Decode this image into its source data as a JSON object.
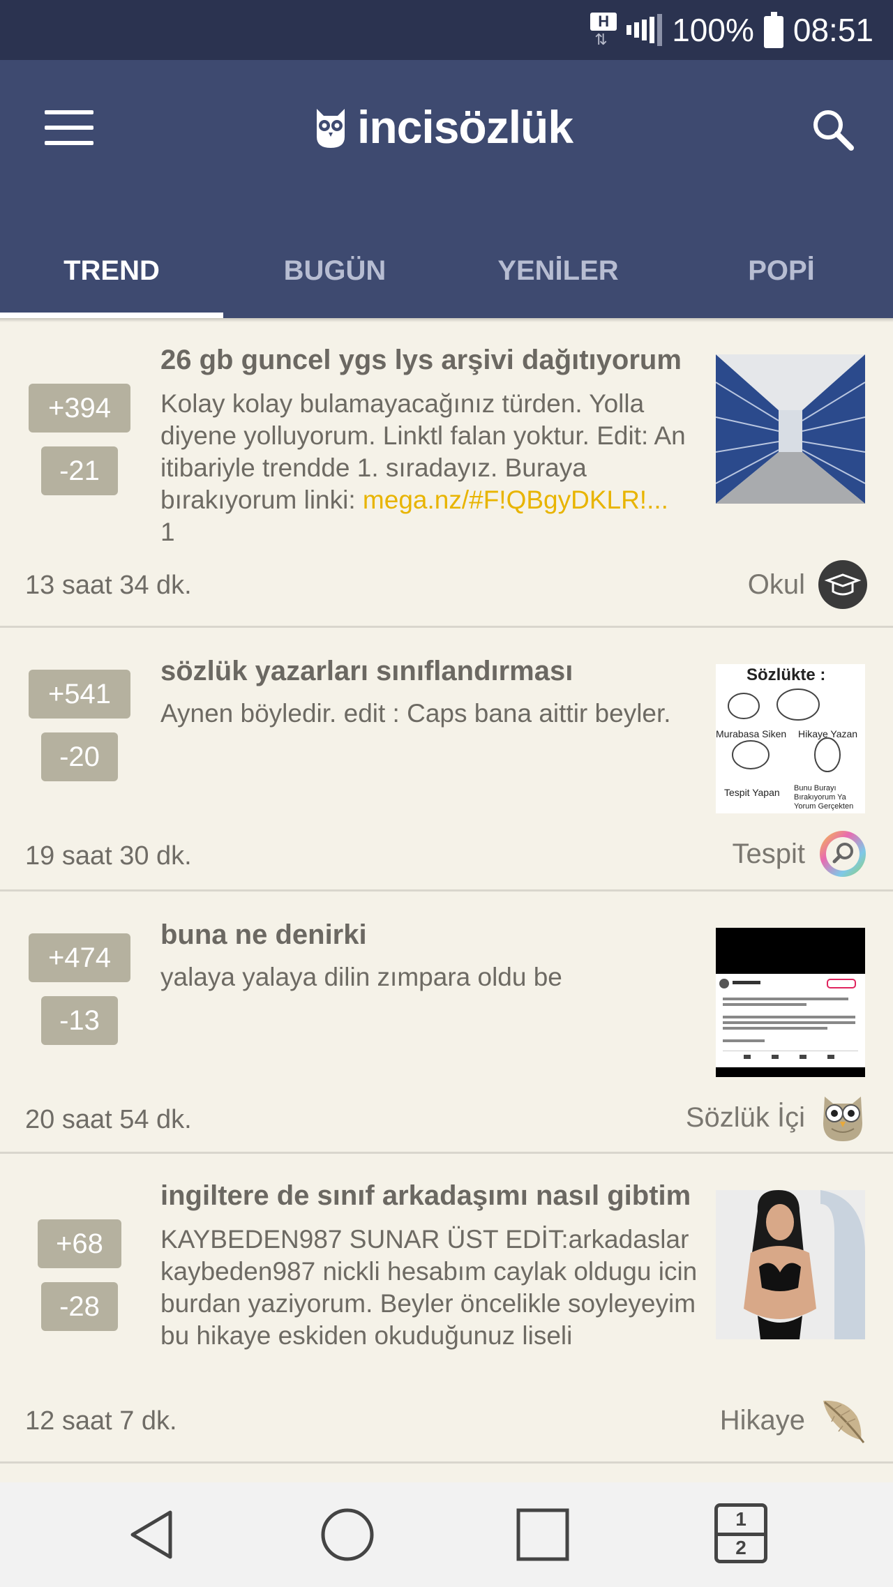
{
  "status_bar": {
    "network_badge": "H",
    "battery": "100%",
    "time": "08:51"
  },
  "app": {
    "logo_text": "incisözlük"
  },
  "tabs": [
    {
      "label": "TREND",
      "active": true
    },
    {
      "label": "BUGÜN",
      "active": false
    },
    {
      "label": "YENİLER",
      "active": false
    },
    {
      "label": "POPİ",
      "active": false
    }
  ],
  "posts": [
    {
      "title": "26 gb guncel ygs lys arşivi dağıtıyorum",
      "excerpt": "Kolay kolay bulamayacağınız türden. Yolla diyene yolluyorum. Linktl falan yoktur. Edit: An itibariyle trendde 1. sıradayız. Buraya bırakıyorum linki: ",
      "link": "mega.nz/#F!QBgyDKLR!...",
      "excerpt_tail": "1",
      "upvotes": "+394",
      "downvotes": "-21",
      "time": "13 saat 34 dk.",
      "category": "Okul",
      "category_icon": "graduation-cap-icon",
      "thumb": "archive-shelves-image"
    },
    {
      "title": "sözlük yazarları sınıflandırması",
      "excerpt": "Aynen böyledir. edit : Caps bana aittir beyler.",
      "upvotes": "+541",
      "downvotes": "-20",
      "time": "19 saat 30 dk.",
      "category": "Tespit",
      "category_icon": "magnifier-rainbow-icon",
      "thumb": "sozlukte-comic-image",
      "thumb_caption": "Sözlükte :",
      "thumb_labels": [
        "Murabasa Siken",
        "Hikaye Yazan",
        "Tespit Yapan",
        "Bunu Burayı Bırakıyorum Ya Yorum Gerçekten"
      ]
    },
    {
      "title": "buna ne denirki",
      "excerpt": "yalaya yalaya dilin zımpara oldu be",
      "upvotes": "+474",
      "downvotes": "-13",
      "time": "20 saat 54 dk.",
      "category": "Sözlük İçi",
      "category_icon": "owl-icon",
      "thumb": "tweet-screenshot-image"
    },
    {
      "title": "ingiltere de sınıf arkadaşımı nasıl gibtim",
      "excerpt": "KAYBEDEN987 SUNAR ÜST EDİT:arkadaslar kaybeden987 nickli hesabım caylak oldugu icin burdan yaziyorum. Beyler öncelikle soyleyeyim bu hikaye eskiden okuduğunuz liseli",
      "upvotes": "+68",
      "downvotes": "-28",
      "time": "12 saat 7 dk.",
      "category": "Hikaye",
      "category_icon": "feather-icon",
      "thumb": "woman-photo-image"
    }
  ],
  "nav": {
    "tabs_count_top": "1",
    "tabs_count_bottom": "2"
  },
  "colors": {
    "status_bar": "#2b3350",
    "app_bar": "#3e4a70",
    "background": "#f5f2e8",
    "vote_badge": "#b5b19f",
    "link": "#e8b400"
  }
}
